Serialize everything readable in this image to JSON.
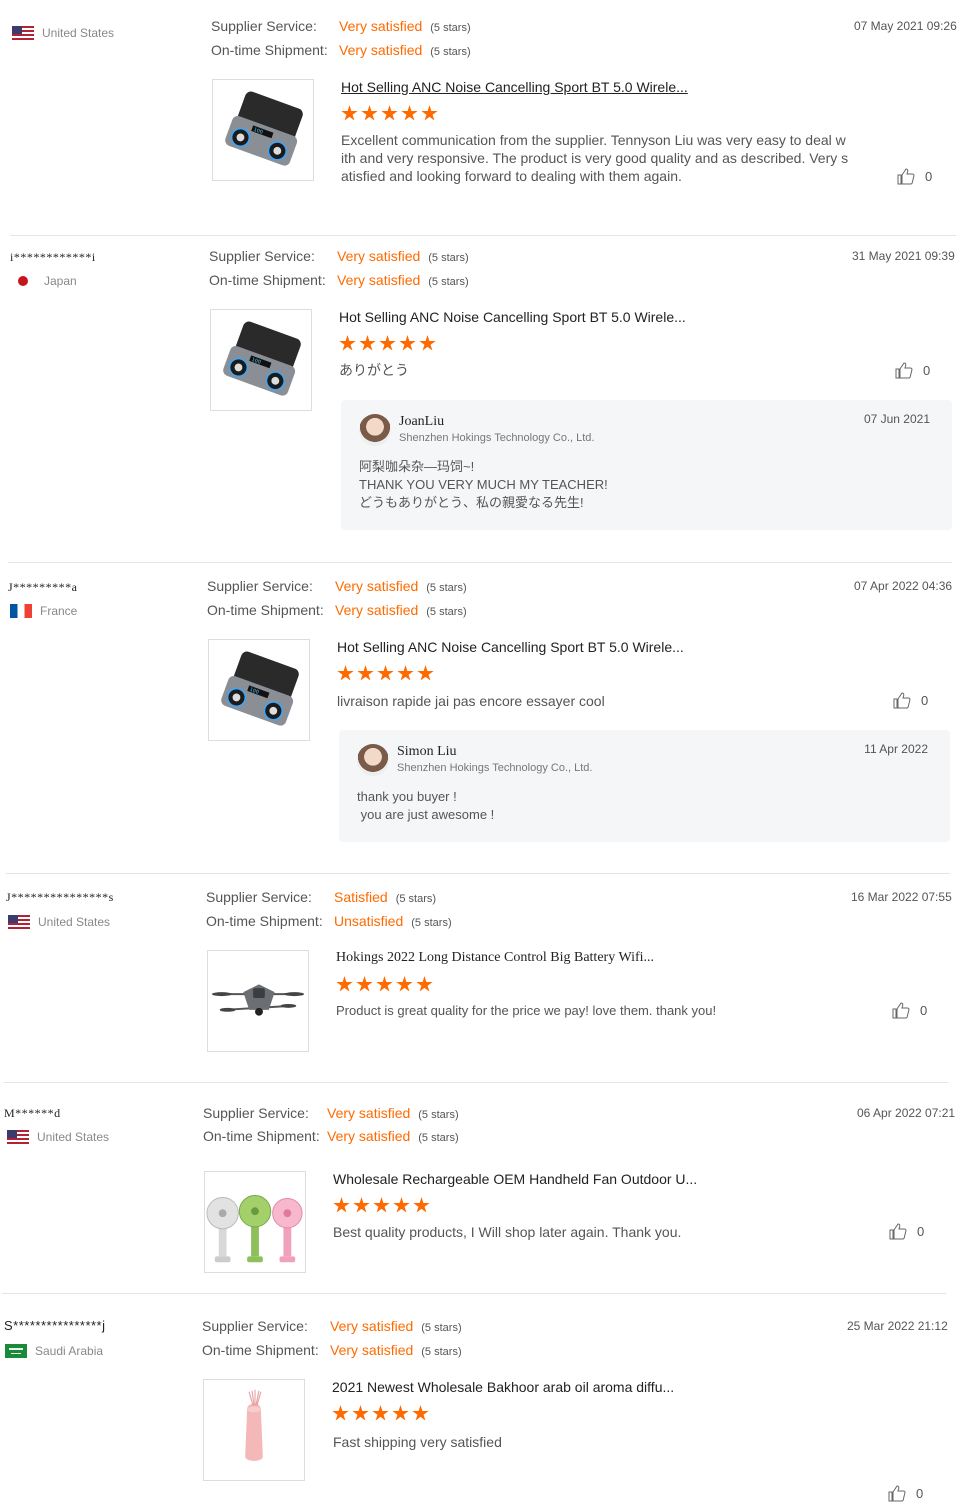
{
  "labels": {
    "supplier_service": "Supplier Service:",
    "ontime_shipment": "On-time Shipment:"
  },
  "colors": {
    "accent": "#ff6a00",
    "divider": "#e5e5e5",
    "reply_bg": "#f5f6f7"
  },
  "reviews": [
    {
      "buyer": "",
      "country": "United States",
      "flag": "us",
      "supplier_service": {
        "value": "Very satisfied",
        "stars": "(5 stars)"
      },
      "ontime_shipment": {
        "value": "Very satisfied",
        "stars": "(5 stars)"
      },
      "date": "07 May 2021 09:26",
      "product_title": "Hot Selling ANC Noise Cancelling Sport BT 5.0 Wirele...",
      "product_image": "earbuds-icon",
      "rating": 5,
      "comment": [
        "Excellent communication from the supplier. Tennyson Liu was very easy to deal w",
        "ith and very responsive. The product is very good quality and as described. Very s",
        "atisfied and looking forward to dealing with them again."
      ],
      "likes": "0"
    },
    {
      "buyer": "i************i",
      "country": "Japan",
      "flag": "jp",
      "supplier_service": {
        "value": "Very satisfied",
        "stars": "(5 stars)"
      },
      "ontime_shipment": {
        "value": "Very satisfied",
        "stars": "(5 stars)"
      },
      "date": "31 May 2021 09:39",
      "product_title": "Hot Selling ANC Noise Cancelling Sport BT 5.0 Wirele...",
      "product_image": "earbuds-icon",
      "rating": 5,
      "comment": [
        "ありがとう"
      ],
      "likes": "0",
      "reply": {
        "name": "JoanLiu",
        "company": "Shenzhen Hokings Technology Co., Ltd.",
        "date": "07 Jun 2021",
        "lines": [
          "阿梨咖朵杂—玛饲~!",
          "THANK YOU VERY MUCH MY TEACHER!",
          "どうもありがとう、私の親愛なる先生!"
        ]
      }
    },
    {
      "buyer": "J*********a",
      "country": "France",
      "flag": "fr",
      "supplier_service": {
        "value": "Very satisfied",
        "stars": "(5 stars)"
      },
      "ontime_shipment": {
        "value": "Very satisfied",
        "stars": "(5 stars)"
      },
      "date": "07 Apr 2022 04:36",
      "product_title": "Hot Selling ANC Noise Cancelling Sport BT 5.0 Wirele...",
      "product_image": "earbuds-icon",
      "rating": 5,
      "comment": [
        "livraison rapide jai pas encore essayer cool"
      ],
      "likes": "0",
      "reply": {
        "name": "Simon Liu",
        "company": "Shenzhen Hokings Technology Co., Ltd.",
        "date": "11 Apr 2022",
        "lines": [
          "thank you buyer !",
          " you are just awesome !"
        ]
      }
    },
    {
      "buyer": "J***************s",
      "country": "United States",
      "flag": "us",
      "supplier_service": {
        "value": "Satisfied",
        "stars": "(5 stars)"
      },
      "ontime_shipment": {
        "value": "Unsatisfied",
        "stars": "(5 stars)"
      },
      "date": "16 Mar 2022 07:55",
      "product_title": "Hokings 2022 Long Distance Control Big Battery Wifi...",
      "product_image": "drone-icon",
      "rating": 5,
      "comment": [
        "Product is great quality for the price we pay! love them. thank you!"
      ],
      "likes": "0"
    },
    {
      "buyer": "M******d",
      "country": "United States",
      "flag": "us",
      "supplier_service": {
        "value": "Very satisfied",
        "stars": "(5 stars)"
      },
      "ontime_shipment": {
        "value": "Very satisfied",
        "stars": "(5 stars)"
      },
      "date": "06 Apr 2022 07:21",
      "product_title": "Wholesale Rechargeable OEM Handheld Fan Outdoor U...",
      "product_image": "fans-icon",
      "rating": 5,
      "comment": [
        "Best quality products, I Will shop later again. Thank you."
      ],
      "likes": "0"
    },
    {
      "buyer": "S****************j",
      "country": "Saudi Arabia",
      "flag": "sa",
      "supplier_service": {
        "value": "Very satisfied",
        "stars": "(5 stars)"
      },
      "ontime_shipment": {
        "value": "Very satisfied",
        "stars": "(5 stars)"
      },
      "date": "25 Mar 2022 21:12",
      "product_title": "2021 Newest Wholesale Bakhoor arab oil aroma diffu...",
      "product_image": "diffuser-icon",
      "rating": 5,
      "comment": [
        "Fast shipping very satisfied"
      ],
      "likes": "0"
    }
  ]
}
